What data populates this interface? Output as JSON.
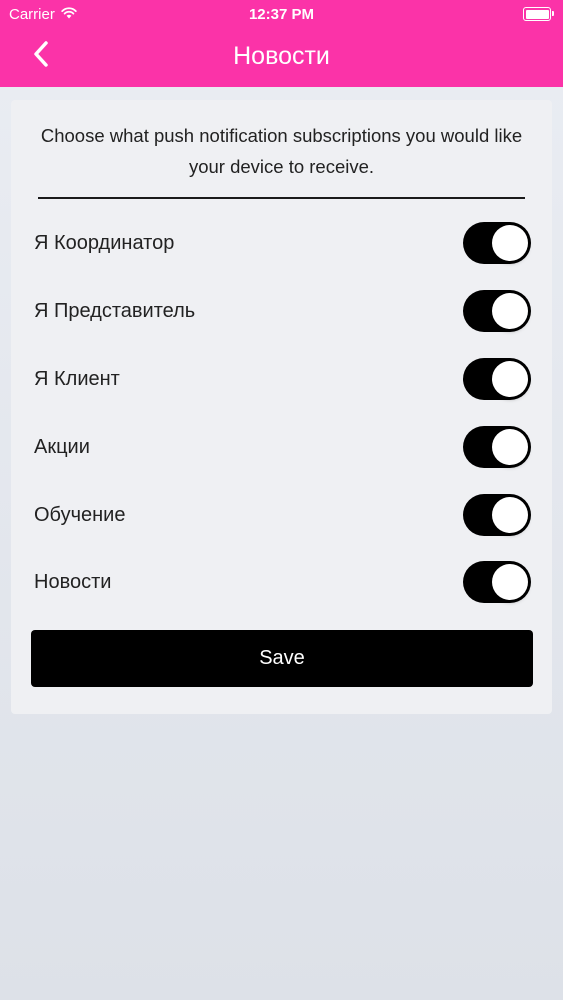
{
  "status_bar": {
    "carrier": "Carrier",
    "time": "12:37 PM",
    "wifi_icon": "wifi-icon",
    "battery_icon": "battery-icon",
    "battery_level": 1.0
  },
  "nav": {
    "title": "Новости",
    "back_icon": "chevron-left-icon",
    "color": "#fb33a8"
  },
  "intro_text": "Choose what push notification subscriptions you would like your device to receive.",
  "subscriptions": [
    {
      "label": "Я Координатор",
      "enabled": true
    },
    {
      "label": "Я Представитель",
      "enabled": true
    },
    {
      "label": "Я Клиент",
      "enabled": true
    },
    {
      "label": "Акции",
      "enabled": true
    },
    {
      "label": "Обучение",
      "enabled": true
    },
    {
      "label": "Новости",
      "enabled": true
    }
  ],
  "save_label": "Save",
  "colors": {
    "accent": "#fb33a8",
    "switch_on": "#000000",
    "button": "#000000"
  }
}
